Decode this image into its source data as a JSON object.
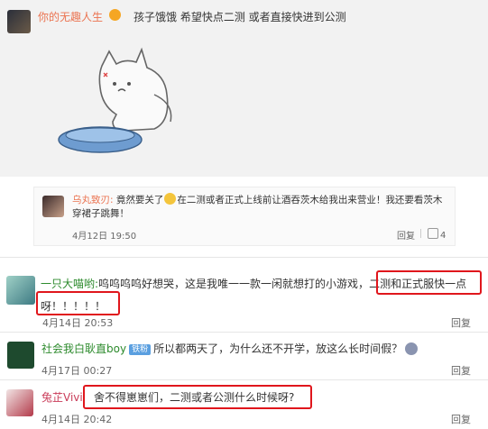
{
  "comment1": {
    "username": "你的无趣人生",
    "text": "孩子饿饿 希望快点二测 或者直接快进到公测"
  },
  "subcomment": {
    "username": "乌丸致刃:",
    "text": "竟然要关了",
    "text2": "在二测或者正式上线前让酒吞茨木给我出来营业！我还要看茨木穿裙子跳舞！",
    "date": "4月12日 19:50",
    "reply": "回复",
    "likes": "4"
  },
  "comment2": {
    "username": "一只大喵哟:",
    "text_a": "呜呜呜呜好想哭，这是我唯一一款一闲就想打的小游戏，",
    "text_b": "二测和正式服快一点",
    "text_c": "呀！！！！！",
    "date": "4月14日 20:53",
    "reply": "回复"
  },
  "comment3": {
    "username": "社会我白耿直boy",
    "badge": "铁粉",
    "text": "所以都两天了，为什么还不开学，放这么长时间假？",
    "date": "4月17日 00:27",
    "reply": "回复"
  },
  "comment4": {
    "username": "兔芷Vivi",
    "text": "舍不得崽崽们，二测或者公测什么时候呀?",
    "date": "4月14日 20:42",
    "reply": "回复"
  }
}
